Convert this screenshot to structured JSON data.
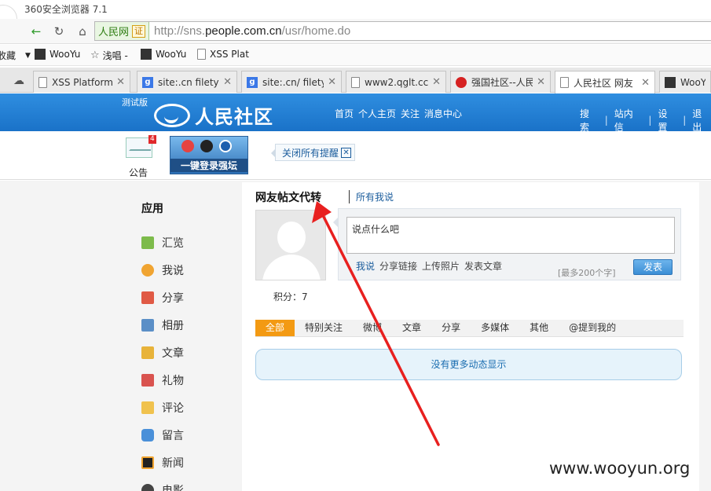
{
  "browser": {
    "title": "360安全浏览器 7.1",
    "site_badge": "人民网",
    "cert_label": "证",
    "url_prefix": "http://sns.",
    "url_domain": "people.com.cn",
    "url_path": "/usr/home.do",
    "bookmarks": [
      {
        "label": "收藏",
        "icon": "star-icon"
      },
      {
        "label": "WooYu",
        "icon": "wooyun-icon"
      },
      {
        "label": "浅唱 -",
        "icon": "star-outline-icon"
      },
      {
        "label": "WooYu",
        "icon": "wooyun-icon"
      },
      {
        "label": "XSS Plat",
        "icon": "page-icon"
      }
    ],
    "tabs": [
      {
        "label": "XSS Platform",
        "icon": "page-icon"
      },
      {
        "label": "site:.cn filetype",
        "icon": "google-icon"
      },
      {
        "label": "site:.cn/ filety",
        "icon": "google-icon"
      },
      {
        "label": "www2.qglt.cc",
        "icon": "page-icon"
      },
      {
        "label": "强国社区--人民",
        "icon": "qiangguo-icon"
      },
      {
        "label": "人民社区 网友",
        "icon": "page-icon"
      },
      {
        "label": "WooYu",
        "icon": "wooyun-icon"
      }
    ]
  },
  "site": {
    "test_tag": "测试版",
    "brand_name": "人民社区",
    "nav": [
      "首页",
      "个人主页",
      "关注",
      "消息中心"
    ],
    "right_nav": [
      "搜索",
      "站内信",
      "设置",
      "退出"
    ],
    "notice_label": "公告",
    "notice_count": "4",
    "login_banner": "一键登录强坛",
    "close_alerts": "关闭所有提醒",
    "close_x": "✕"
  },
  "sidebar": {
    "title": "应用",
    "items": [
      {
        "label": "汇览",
        "color": "#7dbb4b"
      },
      {
        "label": "我说",
        "color": "#f0a431"
      },
      {
        "label": "分享",
        "color": "#e05a45"
      },
      {
        "label": "相册",
        "color": "#5b8fc7"
      },
      {
        "label": "文章",
        "color": "#e8b33a"
      },
      {
        "label": "礼物",
        "color": "#d9534f"
      },
      {
        "label": "评论",
        "color": "#f0c24e"
      },
      {
        "label": "留言",
        "color": "#4a90d9"
      },
      {
        "label": "新闻",
        "color": "#222222"
      },
      {
        "label": "电影",
        "color": "#444444"
      }
    ]
  },
  "profile": {
    "name": "网友帖文代转",
    "all_say": "所有我说",
    "points": "积分：7"
  },
  "composer": {
    "placeholder": "说点什么吧",
    "actions": [
      "我说",
      "分享链接",
      "上传照片",
      "发表文章"
    ],
    "char_limit": "[最多200个字]",
    "publish": "发表"
  },
  "feed": {
    "filters": [
      "全部",
      "特别关注",
      "微博",
      "文章",
      "分享",
      "多媒体",
      "其他",
      "@提到我的"
    ],
    "active_filter": 0,
    "empty_text": "没有更多动态显示"
  },
  "watermark": "www.wooyun.org",
  "colors": {
    "header_blue": "#1f7cd2",
    "active_tab_orange": "#f39a13",
    "annotation_red": "#e8201f"
  }
}
